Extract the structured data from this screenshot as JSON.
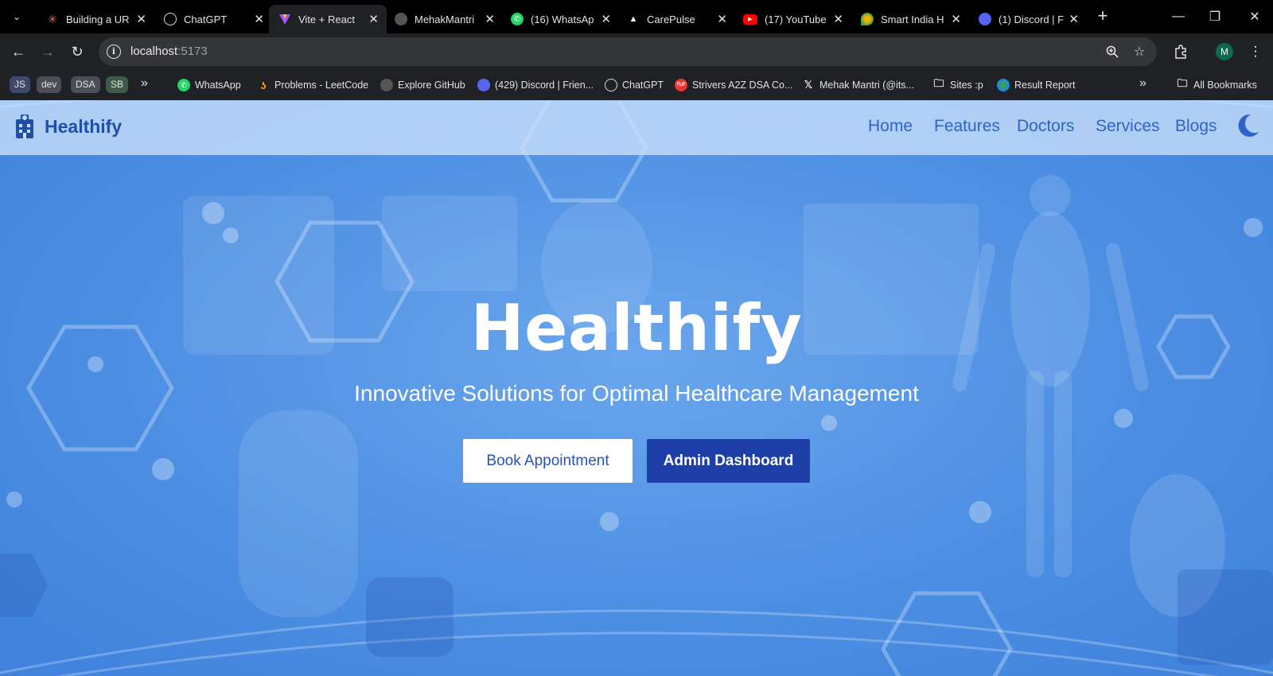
{
  "browser": {
    "tabs": [
      {
        "title": "Building a UR",
        "icon": "claude-icon",
        "color": "#d97757",
        "glyph": "✳"
      },
      {
        "title": "ChatGPT",
        "icon": "chatgpt-icon",
        "color": "#ffffff",
        "glyph": "⚙"
      },
      {
        "title": "Vite + React",
        "icon": "vite-icon",
        "color": "#a855f7",
        "glyph": "▼",
        "active": true
      },
      {
        "title": "MehakMantri",
        "icon": "github-icon",
        "color": "#333333",
        "glyph": "●"
      },
      {
        "title": "(16) WhatsAp",
        "icon": "whatsapp-icon",
        "color": "#25d366",
        "glyph": "✆"
      },
      {
        "title": "CarePulse",
        "icon": "carepulse-icon",
        "color": "#000000",
        "glyph": "▲"
      },
      {
        "title": "(17) YouTube",
        "icon": "youtube-icon",
        "color": "#ff0000",
        "glyph": "▶"
      },
      {
        "title": "Smart India H",
        "icon": "sih-icon",
        "color": "#f4b400",
        "glyph": "●"
      },
      {
        "title": "(1) Discord | F",
        "icon": "discord-icon",
        "color": "#5865f2",
        "glyph": "●"
      }
    ],
    "close_glyph": "✕",
    "new_tab_glyph": "+",
    "url_host": "localhost",
    "url_port": ":5173",
    "profile_initial": "M",
    "bookmark_tags": [
      "JS",
      "dev",
      "DSA",
      "SB"
    ],
    "bookmarks": [
      {
        "title": "WhatsApp",
        "icon": "whatsapp-icon",
        "color": "#25d366"
      },
      {
        "title": "Problems - LeetCode",
        "icon": "leetcode-icon",
        "color": "#ffa116"
      },
      {
        "title": "Explore GitHub",
        "icon": "github-icon",
        "color": "#555555"
      },
      {
        "title": "(429) Discord | Frien...",
        "icon": "discord-icon",
        "color": "#5865f2"
      },
      {
        "title": "ChatGPT",
        "icon": "chatgpt-icon",
        "color": "#ffffff"
      },
      {
        "title": "Strivers A2Z DSA Co...",
        "icon": "tuf-icon",
        "color": "#e53935"
      },
      {
        "title": "Mehak Mantri (@its...",
        "icon": "x-icon",
        "color": "#000000"
      },
      {
        "title": "Sites :p",
        "icon": "folder-icon",
        "color": "#202124"
      },
      {
        "title": "Result Report",
        "icon": "result-icon",
        "color": "#1e88e5"
      }
    ],
    "all_bookmarks": "All Bookmarks"
  },
  "site": {
    "brand": "Healthify",
    "nav": [
      "Home",
      "Features",
      "Doctors",
      "Services",
      "Blogs"
    ],
    "hero_title": "Healthify",
    "hero_subtitle": "Innovative Solutions for Optimal Healthcare Management",
    "btn_book": "Book Appointment",
    "btn_admin": "Admin Dashboard"
  },
  "colors": {
    "hero_bg": "#4d8fe3",
    "nav_link": "#2f63c8",
    "brand": "#1f4fa8",
    "admin_button": "#1f3fa8"
  }
}
